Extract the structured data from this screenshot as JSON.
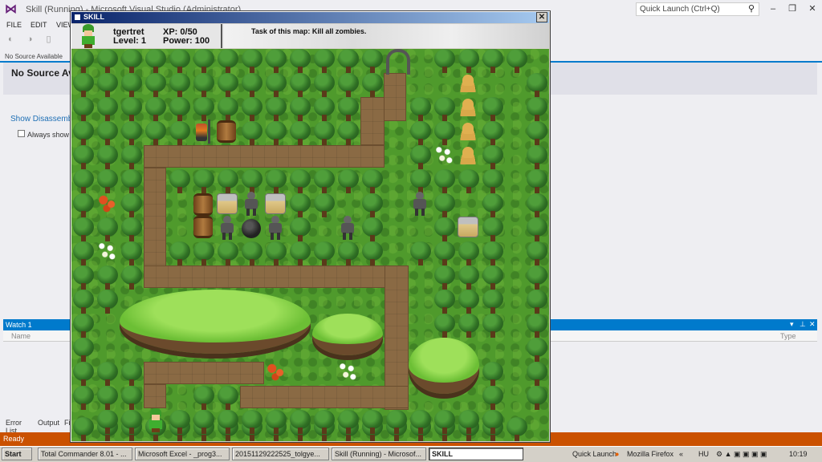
{
  "vs": {
    "title": "Skill (Running) - Microsoft Visual Studio (Administrator)",
    "quick_launch_placeholder": "Quick Launch (Ctrl+Q)",
    "menu": [
      "FILE",
      "EDIT",
      "VIEW"
    ],
    "doc_tab": "No Source Available",
    "doc_heading": "No Source Av",
    "show_disassembly": "Show Disassembly",
    "always_show": "Always show d",
    "watch_title": "Watch 1",
    "watch_col_name": "Name",
    "watch_col_type": "Type",
    "bottom_tabs": [
      "Error List",
      "Output",
      "Fi"
    ],
    "status": "Ready",
    "colors": {
      "accent": "#007acc",
      "status": "#ca5100"
    }
  },
  "game": {
    "window_title": "SKILL",
    "close_label": "✕",
    "hud": {
      "player_name": "tgertret",
      "level": "Level: 1",
      "xp": "XP: 0/50",
      "power": "Power: 100",
      "task": "Task of this map: Kill all zombies."
    }
  },
  "taskbar": {
    "start": "Start",
    "buttons": [
      "Total Commander 8.01 - ...",
      "Microsoft Excel - _prog3...",
      "20151129222525_tolgye...",
      "Skill (Running) - Microsof...",
      "SKILL"
    ],
    "quick_launch": "Quick Launch",
    "firefox": "Mozilla Firefox",
    "lang": "HU",
    "time": "10:19"
  }
}
